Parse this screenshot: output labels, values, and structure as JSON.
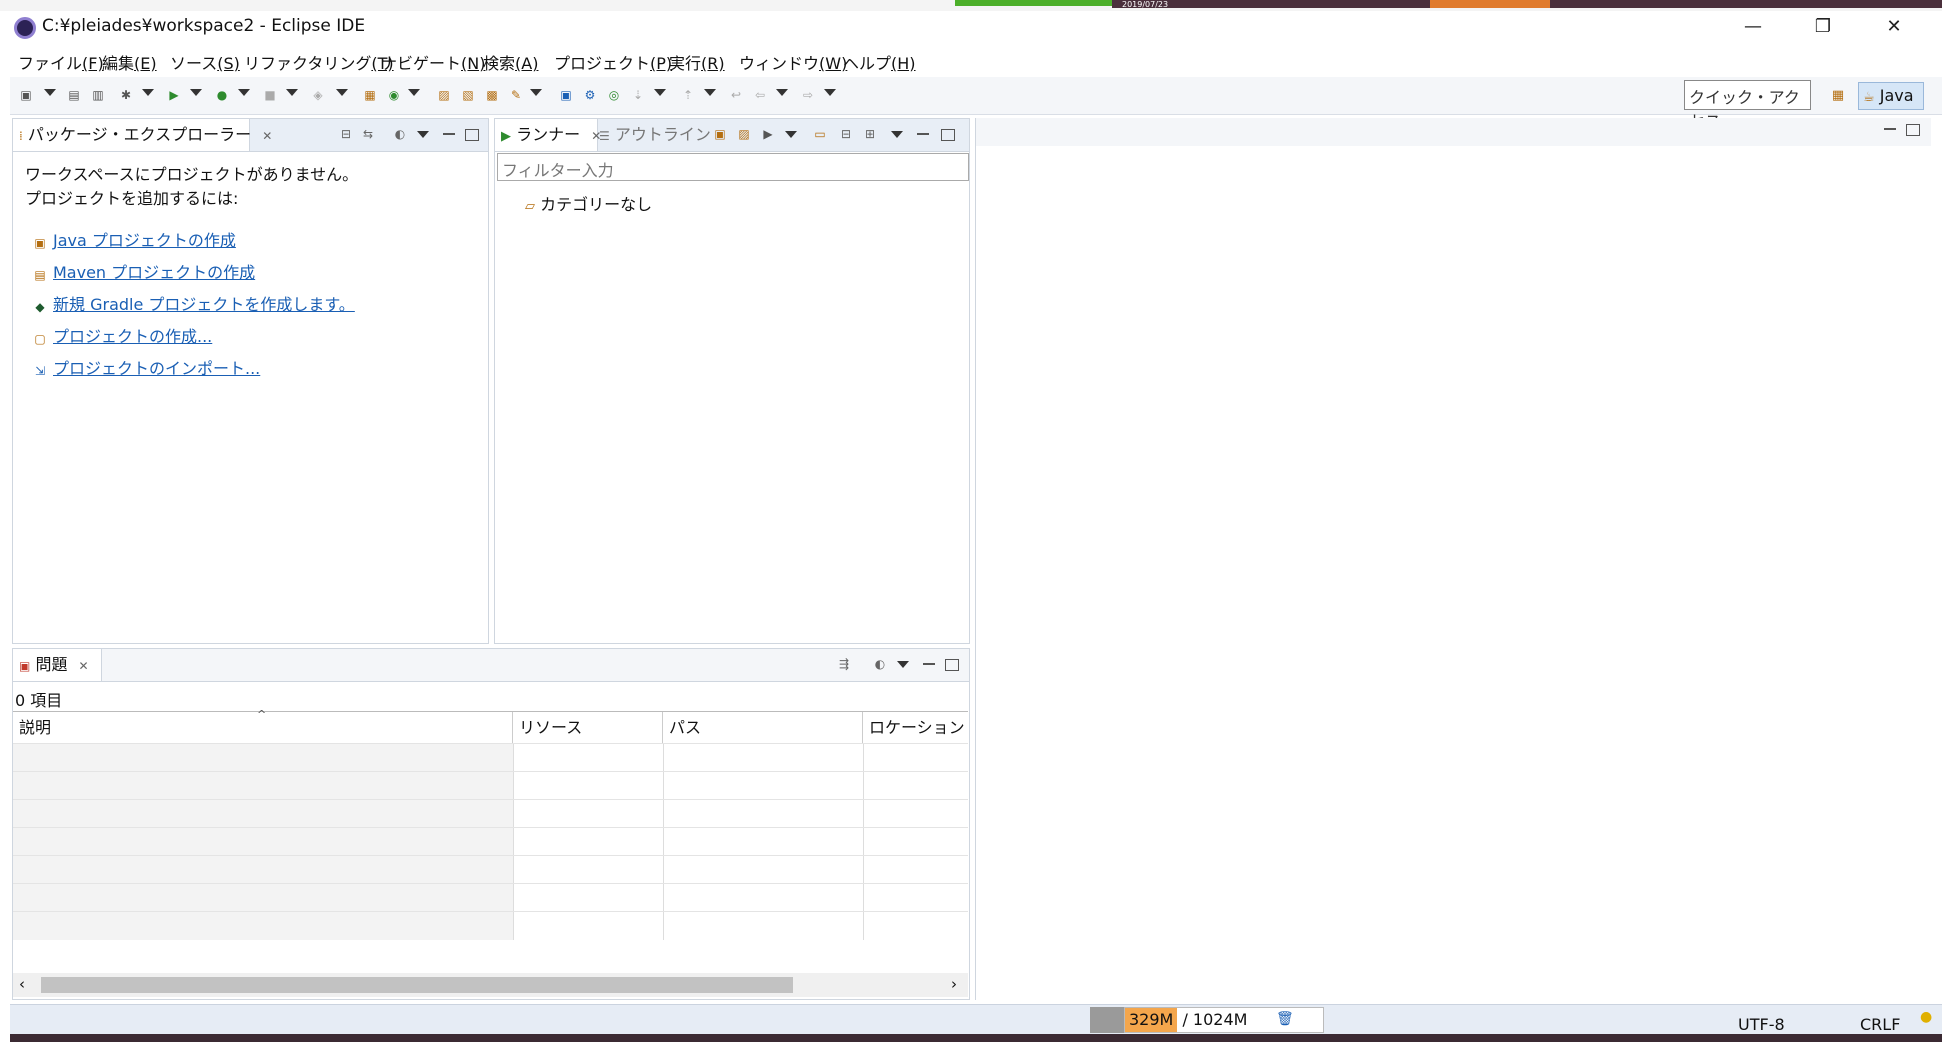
{
  "desktop": {
    "date": "2019/07/23"
  },
  "window": {
    "title": "C:¥pleiades¥workspace2 - Eclipse IDE",
    "controls": {
      "minimize": "—",
      "restore": "❐",
      "close": "✕"
    }
  },
  "menu": [
    {
      "label": "ファイル",
      "mnemonic": "(F)"
    },
    {
      "label": "編集",
      "mnemonic": "(E)"
    },
    {
      "label": "ソース",
      "mnemonic": "(S)"
    },
    {
      "label": "リファクタリング",
      "mnemonic": "(T)"
    },
    {
      "label": "ナビゲート",
      "mnemonic": "(N)"
    },
    {
      "label": "検索",
      "mnemonic": "(A)"
    },
    {
      "label": "プロジェクト",
      "mnemonic": "(P)"
    },
    {
      "label": "実行",
      "mnemonic": "(R)"
    },
    {
      "label": "ウィンドウ",
      "mnemonic": "(W)"
    },
    {
      "label": "ヘルプ",
      "mnemonic": "(H)"
    }
  ],
  "toolbar": {
    "quick_access": "クイック・アクセス",
    "perspective": "Java"
  },
  "package_explorer": {
    "tab_label": "パッケージ・エクスプローラー",
    "message_line1": "ワークスペースにプロジェクトがありません。",
    "message_line2": "プロジェクトを追加するには:",
    "links": [
      {
        "label": "Java プロジェクトの作成",
        "icon": "java-project-icon"
      },
      {
        "label": "Maven プロジェクトの作成",
        "icon": "maven-project-icon"
      },
      {
        "label": "新規 Gradle プロジェクトを作成します。",
        "icon": "gradle-icon"
      },
      {
        "label": "プロジェクトの作成...",
        "icon": "new-project-icon"
      },
      {
        "label": "プロジェクトのインポート...",
        "icon": "import-icon"
      }
    ]
  },
  "runner": {
    "tab_label": "ランナー",
    "outline_label": "アウトライン",
    "filter_placeholder": "フィルター入力",
    "tree_item": "カテゴリーなし"
  },
  "problems": {
    "tab_label": "問題",
    "count": "0 項目",
    "columns": [
      "説明",
      "リソース",
      "パス",
      "ロケーション"
    ]
  },
  "status": {
    "heap_used": "329M",
    "heap_sep": "/",
    "heap_total": "1024M",
    "encoding": "UTF-8",
    "line_ending": "CRLF"
  }
}
